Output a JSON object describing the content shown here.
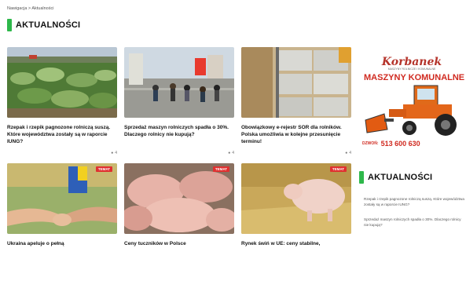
{
  "breadcrumb": "Nawigacja > Aktualności",
  "section_title": "AKTUALNOŚCI",
  "sidebar_title": "AKTUALNOŚCI",
  "accent_color": "#2eb84b",
  "badge_color": "#e03030",
  "cards": [
    {
      "title": "Rzepak i rzepik pagnozone rolniczą suszą. Które województwa zostały są w raporcie IUNG?",
      "meta": "4",
      "badge": ""
    },
    {
      "title": "Sprzedaż maszyn rolniczych spadła o 30%. Dlaczego rolnicy nie kupują?",
      "meta": "4",
      "badge": ""
    },
    {
      "title": "Obowiązkowy e-rejestr SOR dla rolników. Polska umożliwia w kolejne przesunięcie terminu!",
      "meta": "4",
      "badge": ""
    },
    {
      "title": "Ukraina apeluje o pełną",
      "meta": "",
      "badge": "TEMAT"
    },
    {
      "title": "Ceny tuczników w Polsce",
      "meta": "",
      "badge": "TEMAT"
    },
    {
      "title": "Rynek świń w UE: ceny stabilne,",
      "meta": "",
      "badge": "TEMAT"
    }
  ],
  "ad": {
    "brand": "Korbanek",
    "tagline": "MASZYNY ROLNICZE I KOMUNALNE",
    "headline": "MASZYNY KOMUNALNE",
    "phone_label": "DZWOŃ:",
    "phone": "513 600 630"
  },
  "sidebar_items": [
    "Rzepak i rzepik pagnozone rolniczą suszą. Które województwa zostały są w raporcie IUNG?",
    "Sprzedaż maszyn rolniczych spadła o 30%. Dlaczego rolnicy nie kupują?"
  ]
}
